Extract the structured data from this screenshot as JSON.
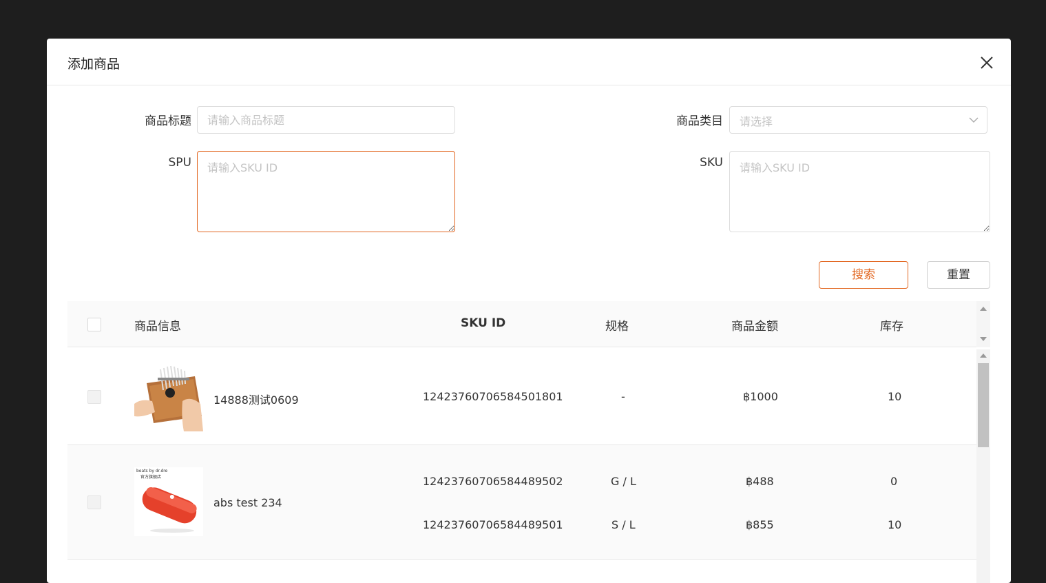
{
  "modal": {
    "title": "添加商品"
  },
  "form": {
    "title_label": "商品标题",
    "title_placeholder": "请输入商品标题",
    "category_label": "商品类目",
    "category_placeholder": "请选择",
    "spu_label": "SPU",
    "spu_placeholder": "请输入SKU ID",
    "sku_label": "SKU",
    "sku_placeholder": "请输入SKU ID",
    "search_label": "搜索",
    "reset_label": "重置"
  },
  "table": {
    "headers": {
      "product_info": "商品信息",
      "sku_id": "SKU ID",
      "spec": "规格",
      "amount": "商品金额",
      "stock": "库存"
    },
    "rows": [
      {
        "name": "14888测试0609",
        "image": "kalimba-photo",
        "skus": [
          {
            "sku_id": "1242376070658450180​1",
            "spec": "-",
            "price": "฿1000",
            "stock": "10"
          }
        ]
      },
      {
        "name": "abs test 234",
        "image": "red-speaker-photo",
        "image_brand_text": "beats by dr.dre",
        "image_subtext": "官方旗舰店",
        "skus": [
          {
            "sku_id": "1242376070658448950​2",
            "spec": "G / L",
            "price": "฿488",
            "stock": "0"
          },
          {
            "sku_id": "1242376070658448950​1",
            "spec": "S / L",
            "price": "฿855",
            "stock": "10"
          }
        ]
      }
    ]
  },
  "colors": {
    "accent": "#e2651e",
    "backdrop": "#1e1e1e",
    "header_bg": "#fafafa"
  }
}
